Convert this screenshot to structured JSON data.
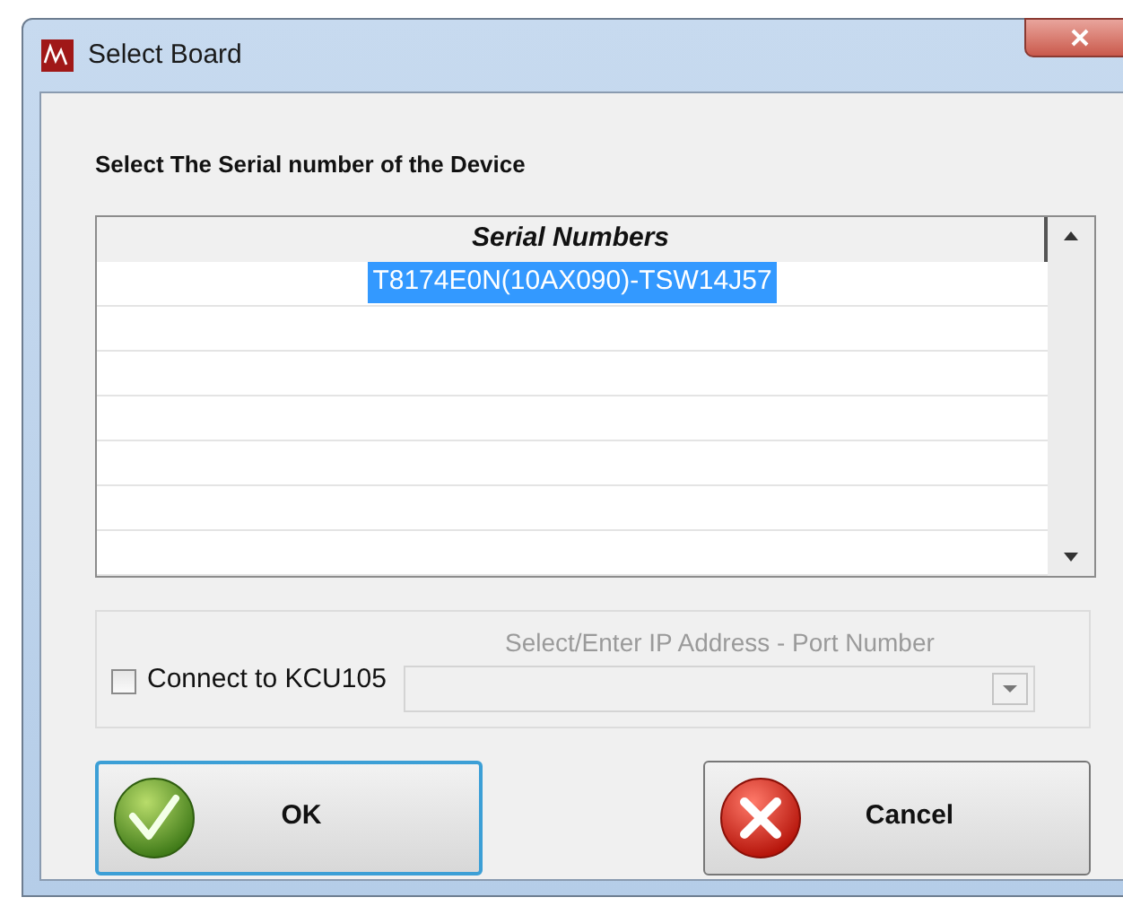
{
  "window": {
    "title": "Select Board"
  },
  "prompt": "Select The Serial number of the Device",
  "table": {
    "columns": [
      "Serial Numbers"
    ],
    "rows": [
      {
        "serial": "T8174E0N(10AX090)-TSW14J57",
        "selected": true
      }
    ]
  },
  "connection": {
    "checkbox": {
      "label": "Connect to KCU105",
      "checked": false
    },
    "ip_field": {
      "label": "Select/Enter IP Address - Port Number",
      "disabled": true
    }
  },
  "buttons": [
    {
      "kind": "ok",
      "label": "OK",
      "focused": true
    },
    {
      "kind": "cancel",
      "label": "Cancel",
      "focused": false
    }
  ]
}
